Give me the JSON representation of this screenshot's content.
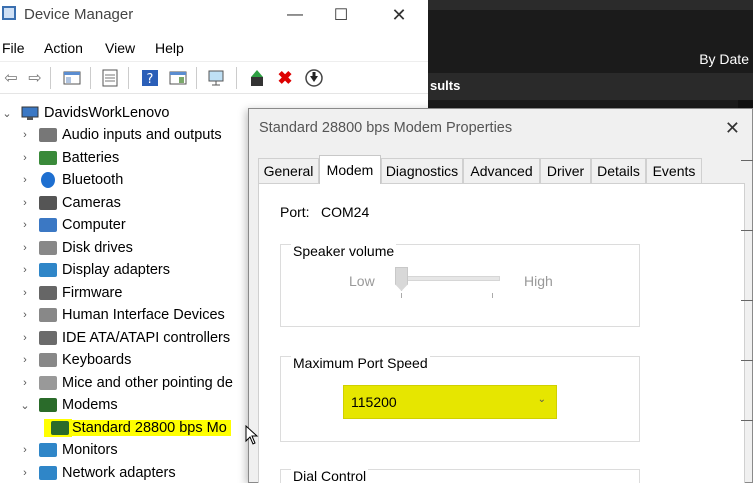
{
  "background_app": {
    "sort_label": "By Date",
    "results_label": "sults"
  },
  "device_manager": {
    "title": "Device Manager",
    "menu": [
      "File",
      "Action",
      "View",
      "Help"
    ],
    "computer_name": "DavidsWorkLenovo",
    "tree": [
      {
        "label": "Audio inputs and outputs",
        "icon": "speaker-icon"
      },
      {
        "label": "Batteries",
        "icon": "battery-icon"
      },
      {
        "label": "Bluetooth",
        "icon": "bluetooth-icon"
      },
      {
        "label": "Cameras",
        "icon": "camera-icon"
      },
      {
        "label": "Computer",
        "icon": "computer-icon"
      },
      {
        "label": "Disk drives",
        "icon": "disk-icon"
      },
      {
        "label": "Display adapters",
        "icon": "display-icon"
      },
      {
        "label": "Firmware",
        "icon": "firmware-icon"
      },
      {
        "label": "Human Interface Devices",
        "icon": "hid-icon"
      },
      {
        "label": "IDE ATA/ATAPI controllers",
        "icon": "ide-icon"
      },
      {
        "label": "Keyboards",
        "icon": "keyboard-icon"
      },
      {
        "label": "Mice and other pointing de",
        "icon": "mouse-icon"
      },
      {
        "label": "Modems",
        "icon": "modem-icon",
        "expanded": true
      },
      {
        "label": "Standard 28800 bps Mo",
        "icon": "modem-icon",
        "child": true,
        "selected": true
      },
      {
        "label": "Monitors",
        "icon": "monitor-icon"
      },
      {
        "label": "Network adapters",
        "icon": "network-icon"
      }
    ]
  },
  "dialog": {
    "title": "Standard 28800 bps Modem Properties",
    "tabs": [
      "General",
      "Modem",
      "Diagnostics",
      "Advanced",
      "Driver",
      "Details",
      "Events"
    ],
    "active_tab": "Modem",
    "port_label": "Port:",
    "port_value": "COM24",
    "speaker_volume": {
      "title": "Speaker volume",
      "low_label": "Low",
      "high_label": "High",
      "level": 0
    },
    "max_port_speed": {
      "title": "Maximum Port Speed",
      "value": "115200"
    },
    "dial_control": {
      "title": "Dial Control"
    }
  },
  "colors": {
    "highlight": "#ffff00",
    "dark_background": "#1b1b1b"
  }
}
